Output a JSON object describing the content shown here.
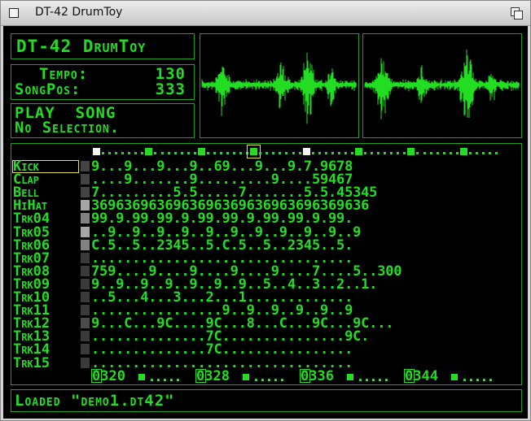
{
  "window": {
    "title": "DT-42 DrumToy"
  },
  "app": {
    "name": "DT-42 DrumToy"
  },
  "transport": {
    "tempo_label": "Tempo:",
    "tempo_value": "130",
    "songpos_label": "SongPos:",
    "songpos_value": "333"
  },
  "status": {
    "line1": "PLAY  SONG",
    "line2": "No Selection."
  },
  "message": "Loaded \"demo1.dt42\"",
  "colors": {
    "lcd_green": "#22dd22",
    "frame_green": "#1ea31e",
    "highlight": "#e8e060"
  },
  "icons": {
    "close": "close-icon",
    "iconify": "iconify-icon"
  },
  "pattern": {
    "beat_markers": [
      "w",
      "g",
      "g",
      "g-boxed",
      "w",
      "g",
      "g",
      "g"
    ],
    "tracks": [
      {
        "name": "Kick",
        "level": 0.15,
        "cells": "9...9...9...9..69...9...9.7.9678"
      },
      {
        "name": "Clap",
        "level": 0.15,
        "cells": "....9.......9.........9....59467"
      },
      {
        "name": "Bell",
        "level": 0.15,
        "cells": "7.........5.5.....7.......5.5.45345"
      },
      {
        "name": "HiHat",
        "level": 0.7,
        "cells": "3696369636963696369636963696369636"
      },
      {
        "name": "Trk04",
        "level": 0.5,
        "cells": "99.9.99.99.9.99.99.9.99.99.9.99."
      },
      {
        "name": "Trk05",
        "level": 0.7,
        "cells": "..9..9..9..9..9..9..9..9..9..9..9"
      },
      {
        "name": "Trk06",
        "level": 0.5,
        "cells": "C.5..5..2345..5.C.5..5..2345..5."
      },
      {
        "name": "Trk07",
        "level": 0.1,
        "cells": "................................"
      },
      {
        "name": "Trk08",
        "level": 0.1,
        "cells": "759....9....9....9....9....7....5..300"
      },
      {
        "name": "Trk09",
        "level": 0.1,
        "cells": "9..9..9..9..9..9..9..5..4..3..2..1."
      },
      {
        "name": "Trk10",
        "level": 0.1,
        "cells": "..5...4...3...2...1............."
      },
      {
        "name": "Trk11",
        "level": 0.1,
        "cells": "................9..9..9..9..9..9"
      },
      {
        "name": "Trk12",
        "level": 0.2,
        "cells": "9...C...9C....9C...8...C...9C...9C..."
      },
      {
        "name": "Trk13",
        "level": 0.1,
        "cells": "..............7C...............9C."
      },
      {
        "name": "Trk14",
        "level": 0.1,
        "cells": "..............7C................"
      },
      {
        "name": "Trk15",
        "level": 0.1,
        "cells": "................................"
      }
    ],
    "positions": [
      "0320",
      "0328",
      "0336",
      "0344"
    ]
  }
}
